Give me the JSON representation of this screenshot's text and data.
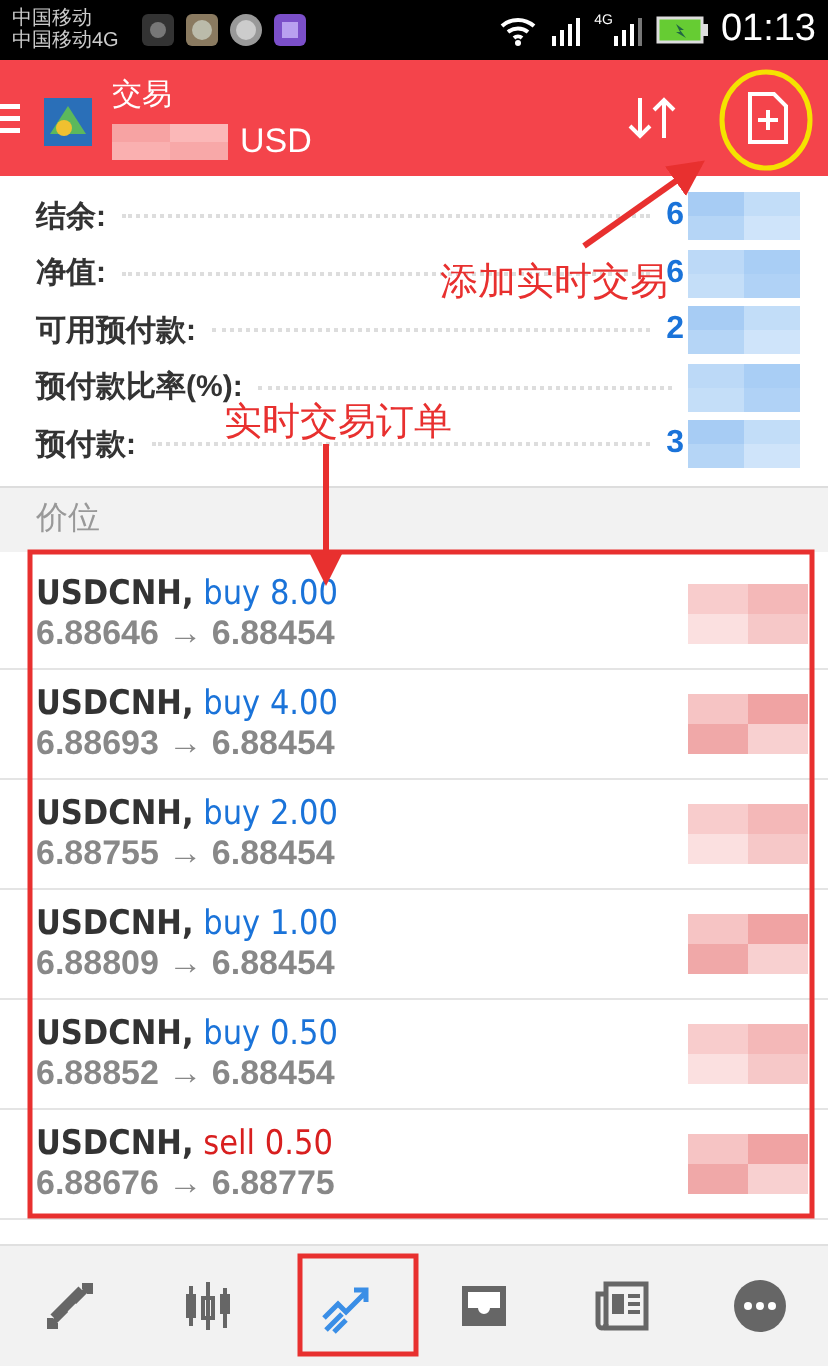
{
  "status_bar": {
    "carriers": [
      "中国移动",
      "中国移动4G"
    ],
    "network_label": "4G",
    "time": "01:13"
  },
  "header": {
    "title": "交易",
    "account": "USD"
  },
  "summary": [
    {
      "label": "结余:",
      "value": "6"
    },
    {
      "label": "净值:",
      "value": "6"
    },
    {
      "label": "可用预付款:",
      "value": "2"
    },
    {
      "label": "预付款比率(%):"
    },
    {
      "label": "预付款:",
      "value": "3"
    }
  ],
  "section_title": "价位",
  "orders": [
    {
      "symbol": "USDCNH,",
      "kind": "buy",
      "deal": "buy 8.00",
      "prices": "6.88646 → 6.88454"
    },
    {
      "symbol": "USDCNH,",
      "kind": "buy",
      "deal": "buy 4.00",
      "prices": "6.88693 → 6.88454"
    },
    {
      "symbol": "USDCNH,",
      "kind": "buy",
      "deal": "buy 2.00",
      "prices": "6.88755 → 6.88454"
    },
    {
      "symbol": "USDCNH,",
      "kind": "buy",
      "deal": "buy 1.00",
      "prices": "6.88809 → 6.88454"
    },
    {
      "symbol": "USDCNH,",
      "kind": "buy",
      "deal": "buy 0.50",
      "prices": "6.88852 → 6.88454"
    },
    {
      "symbol": "USDCNH,",
      "kind": "sell",
      "deal": "sell 0.50",
      "prices": "6.88676 → 6.88775"
    }
  ],
  "nav": [
    {
      "kind": "trade",
      "selected": false
    },
    {
      "kind": "chart",
      "selected": false
    },
    {
      "kind": "trend",
      "selected": true
    },
    {
      "kind": "inbox",
      "selected": false
    },
    {
      "kind": "news",
      "selected": false
    },
    {
      "kind": "more",
      "selected": false
    }
  ],
  "annotations": [
    {
      "kind": "add",
      "text": "添加实时交易"
    },
    {
      "kind": "orders",
      "text": "实时交易订单"
    }
  ]
}
